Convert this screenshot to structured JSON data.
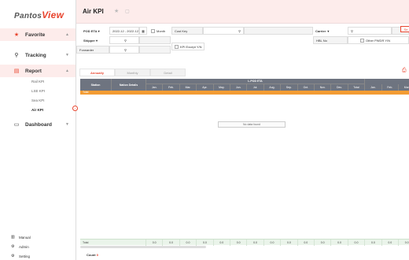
{
  "app": {
    "logo_text": "Pantos",
    "logo_accent": "View"
  },
  "sidebar": {
    "favorite": "Favorite",
    "tracking": "Tracking",
    "report": "Report",
    "report_items": [
      "Rail KPI",
      "LSE KPI",
      "Sea KPI",
      "Air KPI"
    ],
    "dashboard": "Dashboard",
    "bottom": [
      "Manual",
      "Admin",
      "Setting"
    ]
  },
  "header": {
    "title": "Air KPI"
  },
  "filters": {
    "pod_eta": "POD ETA",
    "date_range": "2022-12 - 2022-12",
    "month": "Month",
    "cust_key": "Cust Key",
    "carrier": "Carrier",
    "shipper": "Shipper",
    "hbl_no": "HBL No",
    "other_pwdr": "Other PWDR Y/N",
    "forwarder": "Forwarder",
    "kpi_except": "KPI Except Y/N",
    "search_btn": "Se"
  },
  "tabs": [
    "Annually",
    "Monthly",
    "Detail"
  ],
  "grid": {
    "station": "Station",
    "nation_details": "Nation Details",
    "group_header": "L.POD ETA",
    "months": [
      "Jan.",
      "Feb.",
      "Mar.",
      "Apr.",
      "May.",
      "Jun.",
      "Jul.",
      "Aug.",
      "Sep.",
      "Oct.",
      "Nov.",
      "Dec."
    ],
    "total": "Total",
    "extra": [
      "Jan.",
      "Feb.",
      "Mar."
    ],
    "total_row": "Total",
    "no_data": "No data found",
    "footer_label": "Total",
    "footer_value": "0.0"
  },
  "count_label": "Count",
  "count_value": "0",
  "colors": {
    "accent": "#e8452f",
    "header": "#6e7480",
    "total_row": "#f39c33"
  }
}
